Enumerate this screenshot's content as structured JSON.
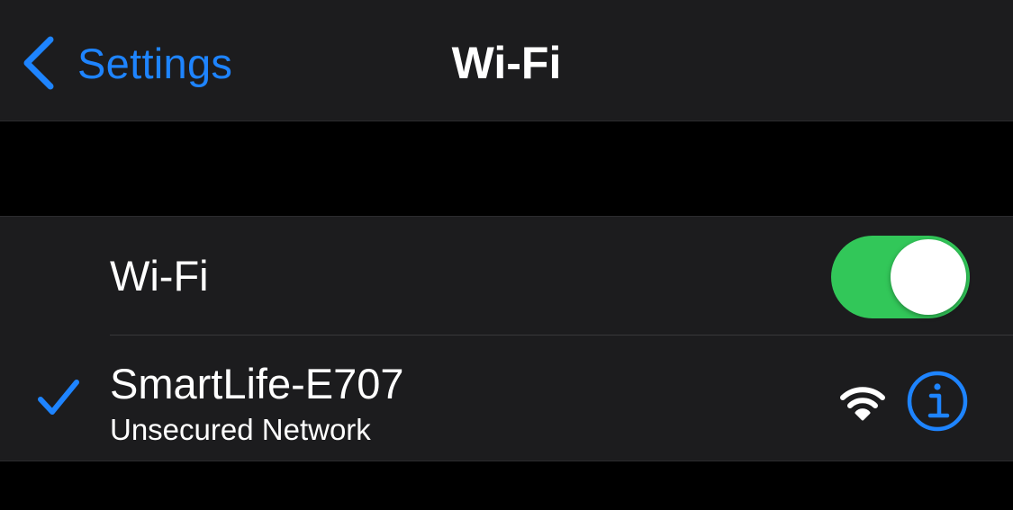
{
  "nav": {
    "back_label": "Settings",
    "title": "Wi-Fi"
  },
  "wifi_row": {
    "label": "Wi-Fi",
    "toggle_on": true
  },
  "network": {
    "name": "SmartLife-E707",
    "subtitle": "Unsecured Network",
    "connected": true,
    "signal_icon": "wifi-signal-icon",
    "info_icon": "info-icon"
  },
  "colors": {
    "accent": "#1e84ff",
    "toggle_on": "#32c759",
    "cell_background": "#1c1c1e",
    "page_background": "#000000"
  }
}
